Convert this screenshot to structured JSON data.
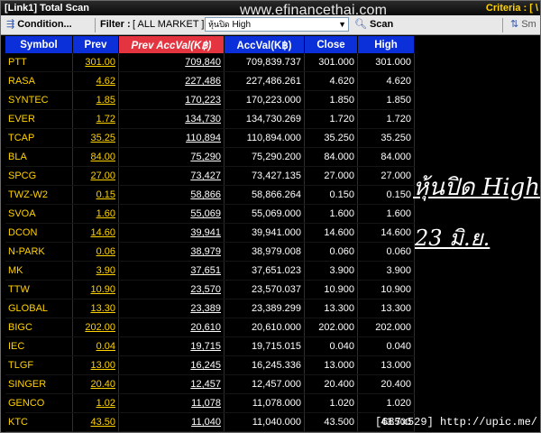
{
  "window": {
    "title": "[Link1] Total Scan",
    "criteria": "Criteria : [ \\"
  },
  "watermark": "www.efinancethai.com",
  "toolbar": {
    "condition_label": "Condition...",
    "filter_label": "Filter :",
    "filter_value": "[ ALL MARKET ]",
    "dropdown_prefix": "หุ้นปิด",
    "dropdown_value": "High",
    "scan_label": "Scan",
    "sm_label": "Sm"
  },
  "table": {
    "columns": [
      "Symbol",
      "Prev",
      "Prev AccVal(K฿)",
      "AccVal(K฿)",
      "Close",
      "High"
    ],
    "rows": [
      [
        "PTT",
        "301.00",
        "709,840",
        "709,839.737",
        "301.000",
        "301.000"
      ],
      [
        "RASA",
        "4.62",
        "227,486",
        "227,486.261",
        "4.620",
        "4.620"
      ],
      [
        "SYNTEC",
        "1.85",
        "170,223",
        "170,223.000",
        "1.850",
        "1.850"
      ],
      [
        "EVER",
        "1.72",
        "134,730",
        "134,730.269",
        "1.720",
        "1.720"
      ],
      [
        "TCAP",
        "35.25",
        "110,894",
        "110,894.000",
        "35.250",
        "35.250"
      ],
      [
        "BLA",
        "84.00",
        "75,290",
        "75,290.200",
        "84.000",
        "84.000"
      ],
      [
        "SPCG",
        "27.00",
        "73,427",
        "73,427.135",
        "27.000",
        "27.000"
      ],
      [
        "TWZ-W2",
        "0.15",
        "58,866",
        "58,866.264",
        "0.150",
        "0.150"
      ],
      [
        "SVOA",
        "1.60",
        "55,069",
        "55,069.000",
        "1.600",
        "1.600"
      ],
      [
        "DCON",
        "14.60",
        "39,941",
        "39,941.000",
        "14.600",
        "14.600"
      ],
      [
        "N-PARK",
        "0.06",
        "38,979",
        "38,979.008",
        "0.060",
        "0.060"
      ],
      [
        "MK",
        "3.90",
        "37,651",
        "37,651.023",
        "3.900",
        "3.900"
      ],
      [
        "TTW",
        "10.90",
        "23,570",
        "23,570.037",
        "10.900",
        "10.900"
      ],
      [
        "GLOBAL",
        "13.30",
        "23,389",
        "23,389.299",
        "13.300",
        "13.300"
      ],
      [
        "BIGC",
        "202.00",
        "20,610",
        "20,610.000",
        "202.000",
        "202.000"
      ],
      [
        "IEC",
        "0.04",
        "19,715",
        "19,715.015",
        "0.040",
        "0.040"
      ],
      [
        "TLGF",
        "13.00",
        "16,245",
        "16,245.336",
        "13.000",
        "13.000"
      ],
      [
        "SINGER",
        "20.40",
        "12,457",
        "12,457.000",
        "20.400",
        "20.400"
      ],
      [
        "GENCO",
        "1.02",
        "11,078",
        "11,078.000",
        "1.020",
        "1.020"
      ],
      [
        "KTC",
        "43.50",
        "11,040",
        "11,040.000",
        "43.500",
        "43.500"
      ]
    ]
  },
  "annotation": {
    "line1": "หุ้นปิด High",
    "line2": "23 มิ.ย."
  },
  "footer": "[687x529] http://upic.me/",
  "colors": {
    "header_bg": "#0b2fd8",
    "active_header_bg": "#e3343f",
    "symbol_text": "#ffd200",
    "background": "#000000"
  }
}
